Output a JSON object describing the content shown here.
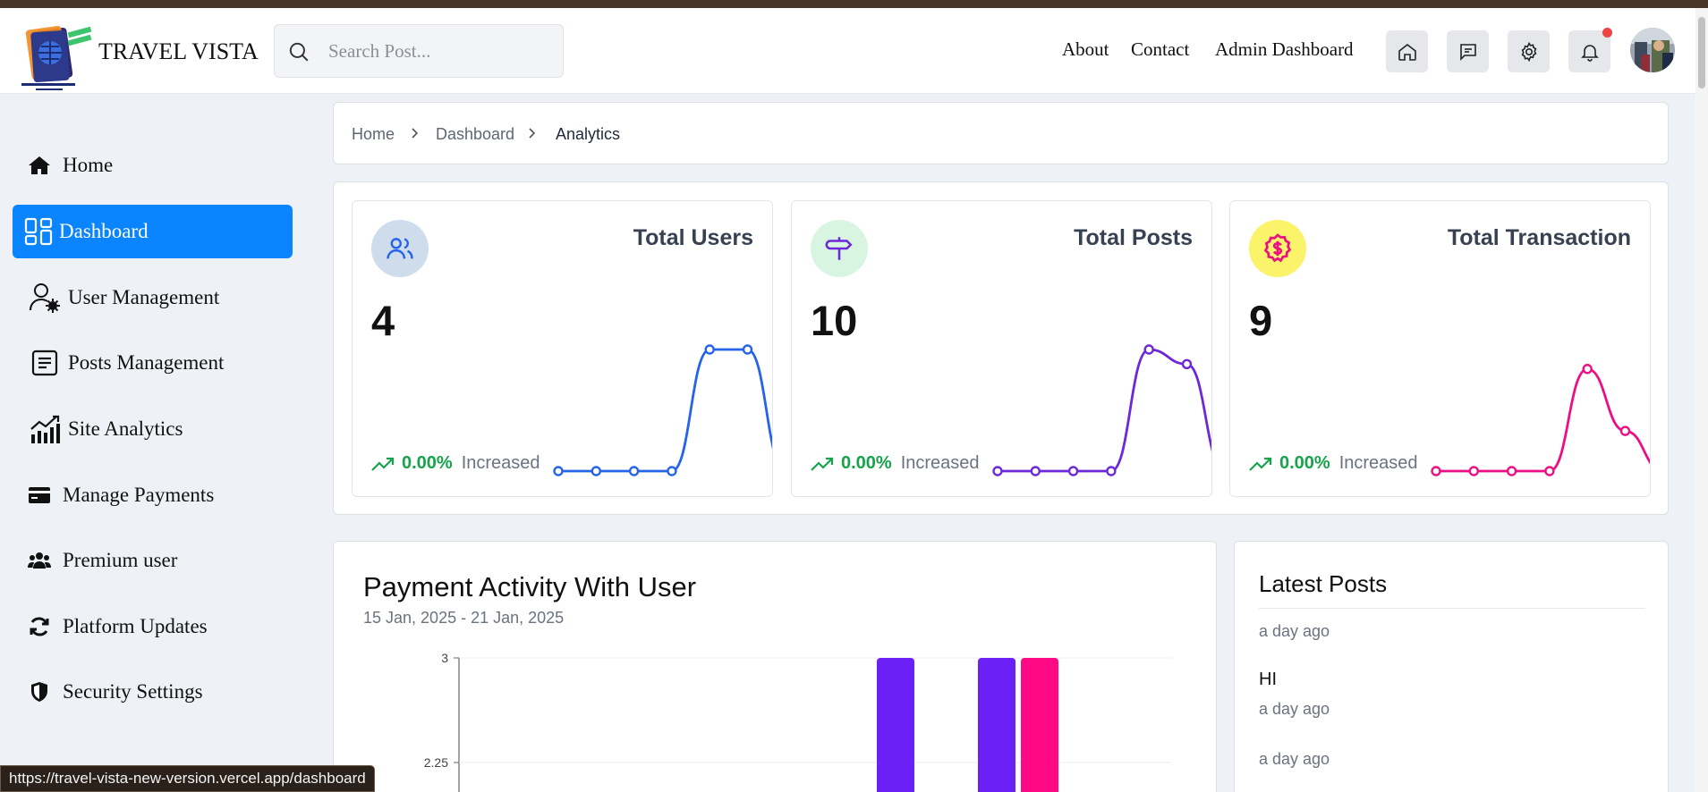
{
  "brand": {
    "name": "TRAVEL VISTA"
  },
  "search": {
    "placeholder": "Search Post..."
  },
  "nav": {
    "about": "About",
    "contact": "Contact",
    "admin": "Admin Dashboard"
  },
  "header_icons": [
    "home-icon",
    "message-icon",
    "gear-icon",
    "bell-icon"
  ],
  "sidebar": {
    "items": [
      {
        "label": "Home",
        "icon": "home-icon"
      },
      {
        "label": "Dashboard",
        "icon": "dashboard-icon",
        "active": true
      },
      {
        "label": "User Management",
        "icon": "user-gear-icon"
      },
      {
        "label": "Posts Management",
        "icon": "document-icon"
      },
      {
        "label": "Site Analytics",
        "icon": "analytics-icon"
      },
      {
        "label": "Manage Payments",
        "icon": "credit-card-icon"
      },
      {
        "label": "Premium user",
        "icon": "users-icon"
      },
      {
        "label": "Platform Updates",
        "icon": "refresh-icon"
      },
      {
        "label": "Security Settings",
        "icon": "shield-icon"
      }
    ]
  },
  "breadcrumb": [
    "Home",
    "Dashboard",
    "Analytics"
  ],
  "stats": [
    {
      "title": "Total Users",
      "value": "4",
      "percent": "0.00%",
      "trend_label": "Increased",
      "color": "#2563eb",
      "icon_bg": "#cfdcec",
      "icon": "users-icon",
      "spark": [
        0,
        0,
        0,
        0,
        1,
        1,
        0
      ]
    },
    {
      "title": "Total Posts",
      "value": "10",
      "percent": "0.00%",
      "trend_label": "Increased",
      "color": "#6d28d9",
      "icon_bg": "#d8f5e2",
      "icon": "signpost-icon",
      "spark": [
        0,
        0,
        0,
        0,
        1,
        0.88,
        0
      ]
    },
    {
      "title": "Total Transaction",
      "value": "9",
      "percent": "0.00%",
      "trend_label": "Increased",
      "color": "#ec0f84",
      "icon_bg": "#fbf36a",
      "icon": "dollar-badge-icon",
      "spark": [
        0,
        0,
        0,
        0,
        0.84,
        0.33,
        0
      ]
    }
  ],
  "payment": {
    "title": "Payment Activity With User",
    "range": "15 Jan, 2025 - 21 Jan, 2025"
  },
  "chart_data": {
    "type": "bar",
    "ytick_labels": [
      "3",
      "2.25"
    ],
    "yticks": [
      3,
      2.25
    ],
    "colors": [
      "#6b21f5",
      "#ff0a84"
    ],
    "visible_bars": [
      {
        "series": 0,
        "value": 3
      },
      {
        "series": 0,
        "value": 3
      },
      {
        "series": 1,
        "value": 3
      }
    ]
  },
  "latest": {
    "title": "Latest Posts",
    "items": [
      {
        "title": "",
        "time": "a day ago"
      },
      {
        "title": "HI",
        "time": "a day ago"
      },
      {
        "title": "",
        "time": "a day ago"
      }
    ]
  },
  "status_url": "https://travel-vista-new-version.vercel.app/dashboard"
}
